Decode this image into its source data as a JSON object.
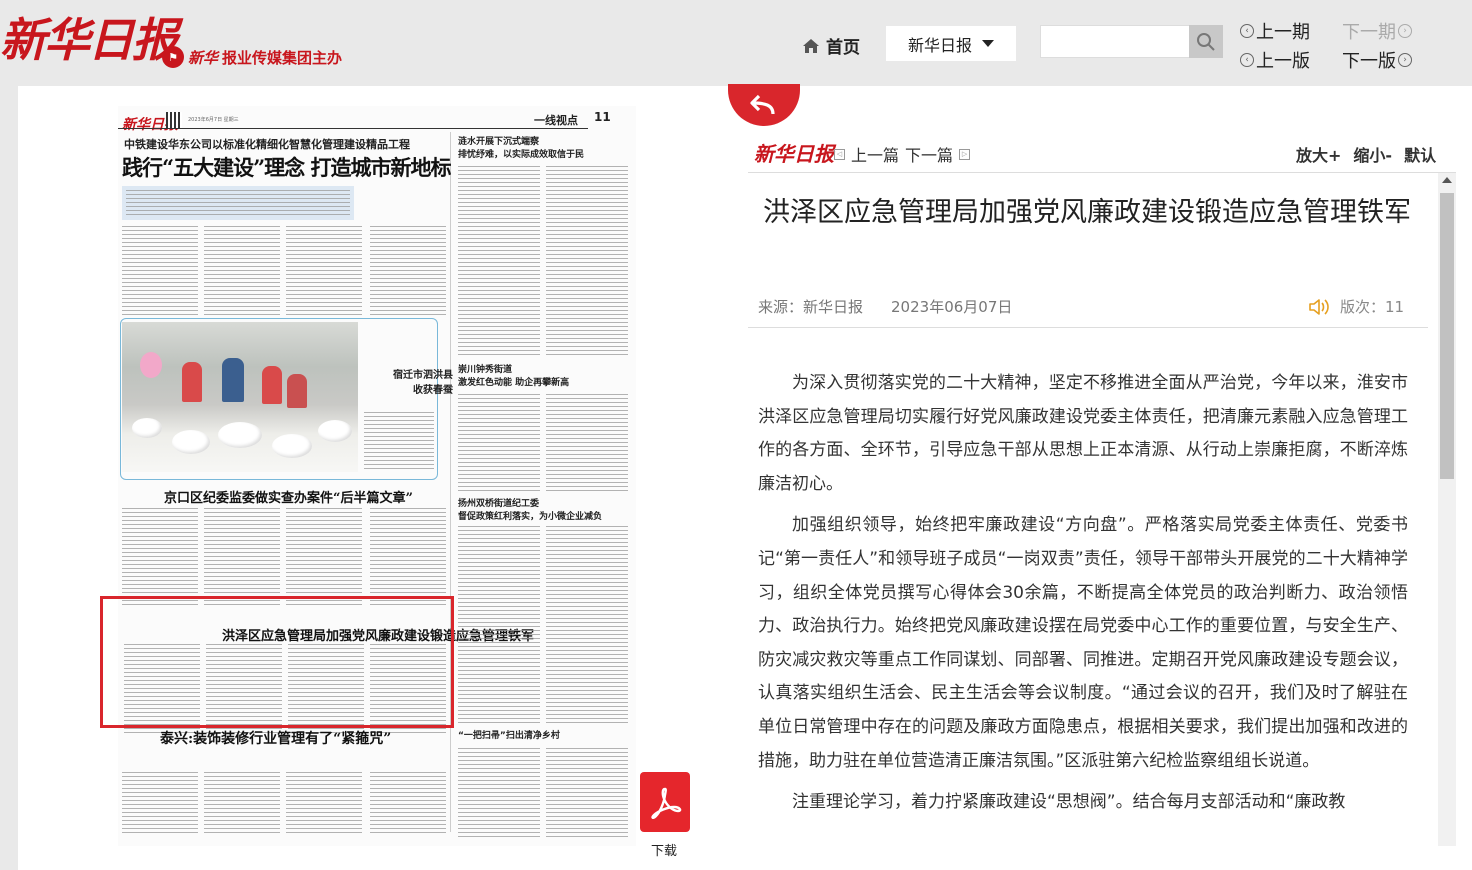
{
  "header": {
    "logo": "新华日报",
    "publisher_brand": "新华",
    "publisher_text": "报业传媒集团主办",
    "home_label": "首页",
    "paper_select": "新华日报",
    "search_placeholder": "",
    "prev_issue": "上一期",
    "next_issue": "下一期",
    "prev_edition": "上一版",
    "next_edition": "下一版"
  },
  "newspaper_page": {
    "logo": "新华日报",
    "date_line": "2023年6月7日 星期三",
    "section": "一线视点",
    "page_number": "11",
    "kicker": "中铁建设华东公司以标准化精细化智慧化管理建设精品工程",
    "headline": "践行“五大建设”理念 打造城市新地标",
    "photo_caption_title": "宿迁市泗洪县",
    "photo_caption_sub": "收获春蚕",
    "story2_title": "京口区纪委监委做实查办案件“后半篇文章”",
    "highlighted_title": "洪泽区应急管理局加强党风廉政建设锻造应急管理铁军",
    "story4_title": "泰兴:装饰装修行业管理有了“紧箍咒”",
    "side1_kicker": "涟水开展下沉式端察",
    "side1_title": "排忧纾难，以实际成效取信于民",
    "side2_kicker": "崇川钟秀街道",
    "side2_title": "激发红色动能 助企再攀新高",
    "side3_kicker": "扬州双桥街道纪工委",
    "side3_title": "督促政策红利落实，为小微企业减负",
    "side4_title": "“一把扫帚”扫出清净乡村",
    "download_label": "下载"
  },
  "article": {
    "prev_article": "上一篇",
    "next_article": "下一篇",
    "zoom_in": "放大+",
    "zoom_out": "缩小-",
    "zoom_default": "默认",
    "title": "洪泽区应急管理局加强党风廉政建设锻造应急管理铁军",
    "source": "来源：新华日报",
    "date": "2023年06月07日",
    "edition": "版次：11",
    "paragraphs": [
      "为深入贯彻落实党的二十大精神，坚定不移推进全面从严治党，今年以来，淮安市洪泽区应急管理局切实履行好党风廉政建设党委主体责任，把清廉元素融入应急管理工作的各方面、全环节，引导应急干部从思想上正本清源、从行动上崇廉拒腐，不断淬炼廉洁初心。",
      "加强组织领导，始终把牢廉政建设“方向盘”。严格落实局党委主体责任、党委书记“第一责任人”和领导班子成员“一岗双责”责任，领导干部带头开展党的二十大精神学习，组织全体党员撰写心得体会30余篇，不断提高全体党员的政治判断力、政治领悟力、政治执行力。始终把党风廉政建设摆在局党委中心工作的重要位置，与安全生产、防灾减灾救灾等重点工作同谋划、同部署、同推进。定期召开党风廉政建设专题会议，认真落实组织生活会、民主生活会等会议制度。“通过会议的召开，我们及时了解驻在单位日常管理中存在的问题及廉政方面隐患点，根据相关要求，我们提出加强和改进的措施，助力驻在单位营造清正廉洁氛围。”区派驻第六纪检监察组组长说道。",
      "注重理论学习，着力拧紧廉政建设“思想阀”。结合每月支部活动和“廉政教"
    ]
  },
  "colors": {
    "brand_red": "#c8161d",
    "highlight_red": "#d9262c",
    "photo_frame": "#79b8d9"
  }
}
